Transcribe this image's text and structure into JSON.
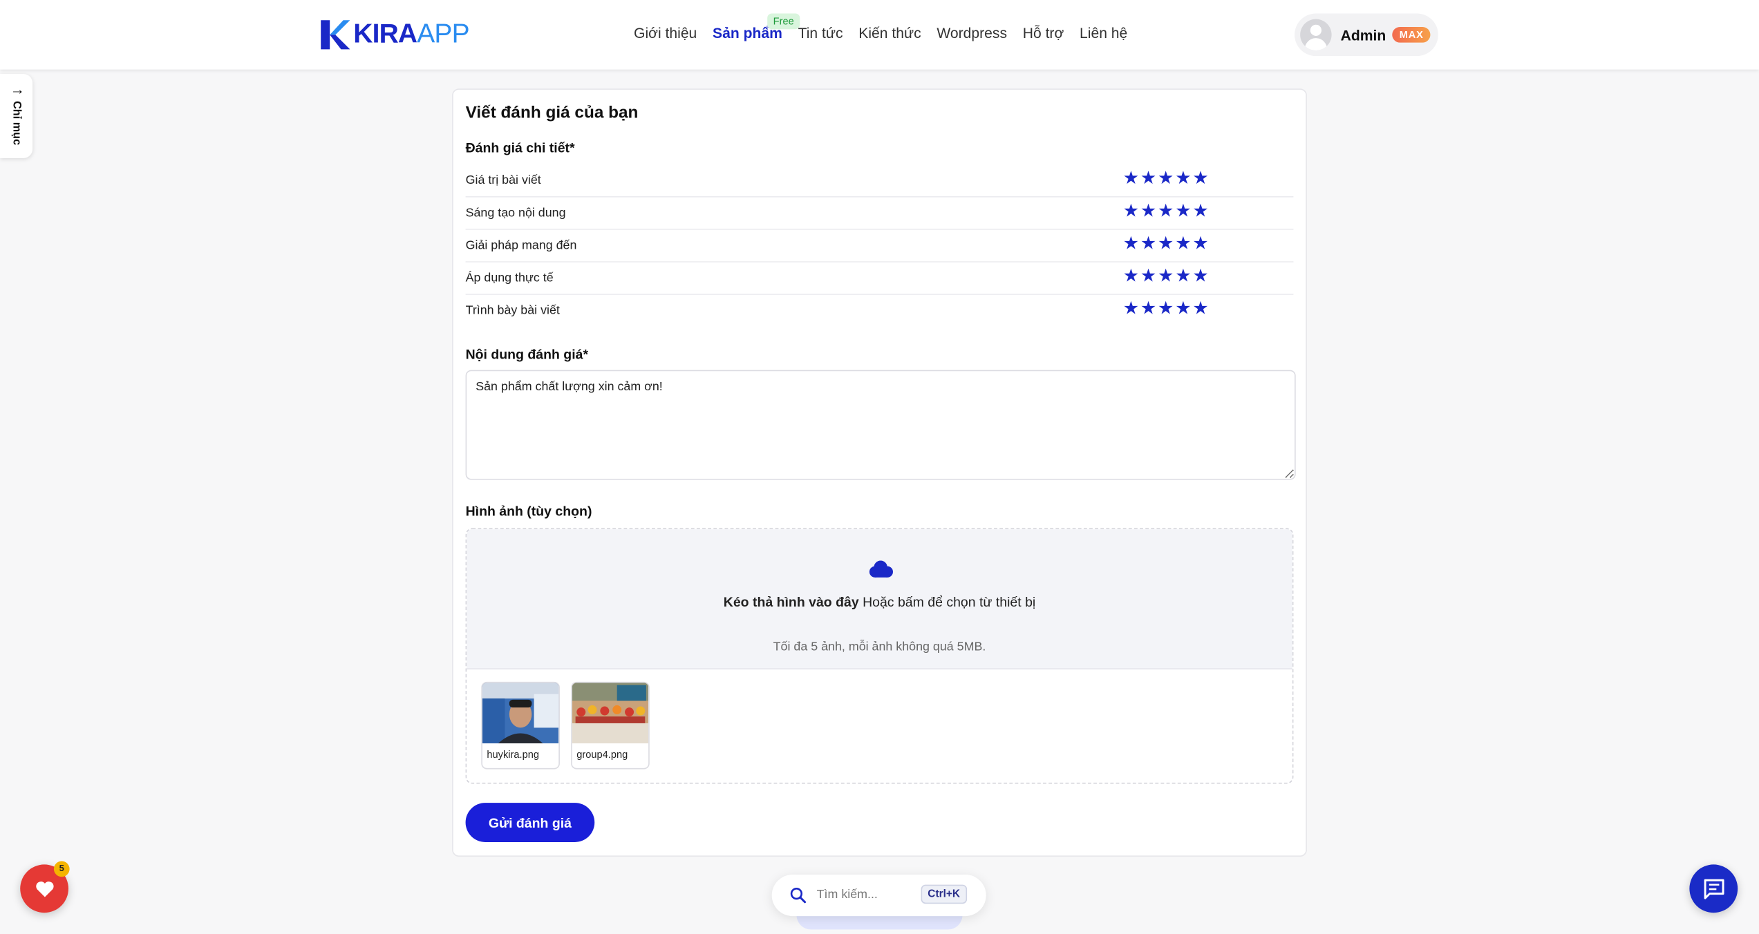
{
  "header": {
    "logo": {
      "brand_main": "KIRA",
      "brand_accent": "APP"
    },
    "nav": [
      {
        "label": "Giới thiệu",
        "active": false
      },
      {
        "label": "Sản phẩm",
        "active": true,
        "badge": "Free"
      },
      {
        "label": "Tin tức",
        "active": false
      },
      {
        "label": "Kiến thức",
        "active": false
      },
      {
        "label": "Wordpress",
        "active": false
      },
      {
        "label": "Hỗ trợ",
        "active": false
      },
      {
        "label": "Liên hệ",
        "active": false
      }
    ],
    "user": {
      "name": "Admin",
      "plan_badge": "MAX"
    }
  },
  "side_tab": {
    "label": "Chỉ mục",
    "icon": "arrow-right-icon"
  },
  "review_form": {
    "title": "Viết đánh giá của bạn",
    "ratings_label": "Đánh giá chi tiết*",
    "criteria": [
      {
        "label": "Giá trị bài viết",
        "stars": 5,
        "max": 5
      },
      {
        "label": "Sáng tạo nội dung",
        "stars": 5,
        "max": 5
      },
      {
        "label": "Giải pháp mang đến",
        "stars": 5,
        "max": 5
      },
      {
        "label": "Áp dụng thực tế",
        "stars": 5,
        "max": 5
      },
      {
        "label": "Trình bày bài viết",
        "stars": 5,
        "max": 5
      }
    ],
    "content_label": "Nội dung đánh giá*",
    "content_value": "Sản phẩm chất lượng xin cảm ơn!",
    "images_label": "Hình ảnh (tùy chọn)",
    "dropzone": {
      "icon": "cloud-upload-icon",
      "bold_text": "Kéo thả hình vào đây",
      "text": " Hoặc bấm để chọn từ thiết bị",
      "hint": "Tối đa 5 ảnh, mỗi ảnh không quá 5MB."
    },
    "uploaded_images": [
      {
        "filename": "huykira.png"
      },
      {
        "filename": "group4.png"
      }
    ],
    "submit_label": "Gửi đánh giá"
  },
  "search": {
    "placeholder": "Tìm kiếm...",
    "shortcut": "Ctrl+K",
    "icon": "search-icon"
  },
  "floating": {
    "favorites": {
      "icon": "heart-icon",
      "count": "5"
    },
    "chat": {
      "icon": "chat-icon"
    }
  },
  "colors": {
    "accent": "#1a28c7",
    "button": "#1a1fd9",
    "heart": "#e53935"
  }
}
